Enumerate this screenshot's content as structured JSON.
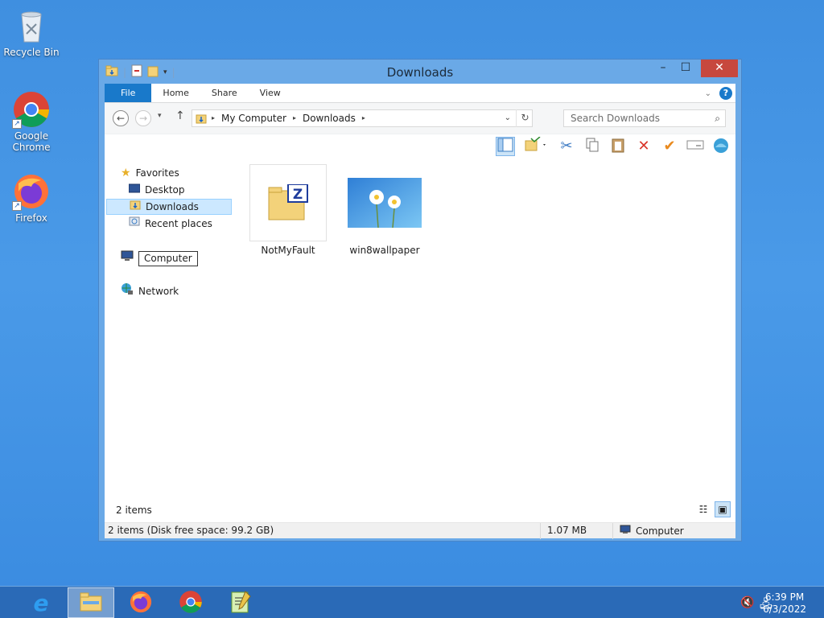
{
  "desktop": {
    "icons": [
      {
        "label": "Recycle Bin",
        "icon": "recycle-bin-icon"
      },
      {
        "label": "Google Chrome",
        "icon": "chrome-icon"
      },
      {
        "label": "Firefox",
        "icon": "firefox-icon"
      }
    ]
  },
  "window": {
    "title": "Downloads",
    "controls": {
      "minimize": "–",
      "maximize": "☐",
      "close": "✕"
    },
    "ribbon": {
      "tabs": [
        "File",
        "Home",
        "Share",
        "View"
      ],
      "help": "?"
    },
    "address": {
      "crumbs": [
        "My Computer",
        "Downloads"
      ],
      "search_placeholder": "Search Downloads"
    },
    "nav_pane": {
      "favorites": "Favorites",
      "items": [
        "Desktop",
        "Downloads",
        "Recent places"
      ],
      "computer": "Computer",
      "network": "Network"
    },
    "files": [
      {
        "name": "NotMyFault",
        "icon": "zip-folder-icon"
      },
      {
        "name": "win8wallpaper",
        "icon": "image-thumbnail"
      }
    ],
    "item_count": "2 items",
    "statusbar": {
      "summary": "2 items (Disk free space: 99.2 GB)",
      "size": "1.07 MB",
      "location": "Computer"
    }
  },
  "taskbar": {
    "apps": [
      "internet-explorer-icon",
      "file-explorer-icon",
      "firefox-icon",
      "chrome-icon",
      "notepad-plus-icon"
    ],
    "time": "6:39 PM",
    "date": "6/3/2022"
  },
  "colors": {
    "accent": "#1979ca",
    "close": "#c7483e",
    "selection": "#cce8ff"
  }
}
